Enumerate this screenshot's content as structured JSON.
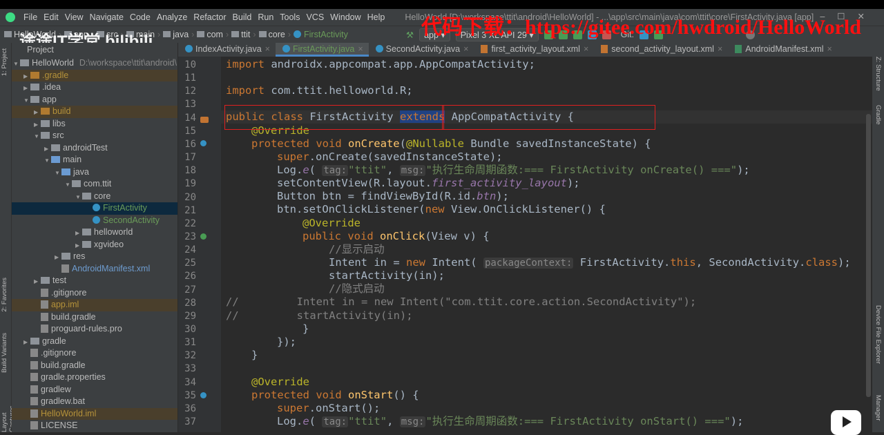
{
  "menu": [
    "File",
    "Edit",
    "View",
    "Navigate",
    "Code",
    "Analyze",
    "Refactor",
    "Build",
    "Run",
    "Tools",
    "VCS",
    "Window",
    "Help"
  ],
  "window_title": "HelloWorld [D:\\workspace\\ttit\\android\\HelloWorld] - ...\\app\\src\\main\\java\\com\\ttit\\core\\FirstActivity.java [app]",
  "watermark": "代码下载：https://gitee.com/hwdroid/HelloWorld",
  "overlay_logo": "途途IT学堂 bilibili",
  "breadcrumb": [
    "HelloWorld",
    "app",
    "src",
    "main",
    "java",
    "com",
    "ttit",
    "core",
    "FirstActivity"
  ],
  "toolbar": {
    "run_config": "app",
    "device": "Pixel 3 XL API 29",
    "git_label": "Git:"
  },
  "panel": {
    "title": "Project"
  },
  "left_stripe": [
    "1: Project",
    "2: Favorites",
    "Build Variants",
    "Layout Captures"
  ],
  "right_stripe": [
    "Z: Structure",
    "Gradle",
    "Device File Explorer",
    "Resource Manager"
  ],
  "tree": [
    {
      "label": "HelloWorld",
      "path": "D:\\workspace\\ttit\\android\\HelloWo"
    },
    {
      "label": ".gradle"
    },
    {
      "label": ".idea"
    },
    {
      "label": "app"
    },
    {
      "label": "build"
    },
    {
      "label": "libs"
    },
    {
      "label": "src"
    },
    {
      "label": "androidTest"
    },
    {
      "label": "main"
    },
    {
      "label": "java"
    },
    {
      "label": "com.ttit"
    },
    {
      "label": "core"
    },
    {
      "label": "FirstActivity"
    },
    {
      "label": "SecondActivity"
    },
    {
      "label": "helloworld"
    },
    {
      "label": "xgvideo"
    },
    {
      "label": "res"
    },
    {
      "label": "AndroidManifest.xml"
    },
    {
      "label": "test"
    },
    {
      "label": ".gitignore"
    },
    {
      "label": "app.iml"
    },
    {
      "label": "build.gradle"
    },
    {
      "label": "proguard-rules.pro"
    },
    {
      "label": "gradle"
    },
    {
      "label": ".gitignore"
    },
    {
      "label": "build.gradle"
    },
    {
      "label": "gradle.properties"
    },
    {
      "label": "gradlew"
    },
    {
      "label": "gradlew.bat"
    },
    {
      "label": "HelloWorld.iml"
    },
    {
      "label": "LICENSE"
    }
  ],
  "tabs": [
    "IndexActivity.java",
    "FirstActivity.java",
    "SecondActivity.java",
    "first_activity_layout.xml",
    "second_activity_layout.xml",
    "AndroidManifest.xml"
  ],
  "line_numbers": [
    "10",
    "11",
    "12",
    "13",
    "14",
    "15",
    "16",
    "17",
    "18",
    "19",
    "20",
    "21",
    "22",
    "23",
    "24",
    "25",
    "26",
    "27",
    "28",
    "29",
    "30",
    "31",
    "32",
    "33",
    "34",
    "35",
    "36",
    "37"
  ],
  "code": {
    "l10a": "import ",
    "l10b": "androidx.appcompat.app.AppCompatActivity;",
    "l12a": "import ",
    "l12b": "com.ttit.helloworld.R;",
    "l14a": "public class ",
    "l14b": "FirstActivity ",
    "l14c": "extends",
    "l14d": " AppCompatActivity {",
    "ov": "@Override",
    "l16a": "protected void ",
    "l16b": "onCreate",
    "l16c": "(",
    "l16d": "@Nullable",
    "l16e": " Bundle savedInstanceState) {",
    "l17a": "super",
    "l17b": ".onCreate(savedInstanceState);",
    "l18a": "Log.",
    "l18b": "e",
    "l18c": "( ",
    "tag": "tag:",
    "l18d": "\"ttit\"",
    ", ": ", ",
    "msg": "msg:",
    "l18e": "\"执行生命周期函数:=== FirstActivity onCreate() ===\"",
    "l18f": ");",
    "l19a": "setContentView(R.layout.",
    "l19b": "first_activity_layout",
    "l19c": ");",
    "l20a": "Button btn = findViewById(R.id.",
    "l20b": "btn",
    "l20c": ");",
    "l21a": "btn.setOnClickListener(",
    "l21b": "new ",
    "l21c": "View.OnClickListener() {",
    "l23a": "public void ",
    "l23b": "onClick",
    "l23c": "(View v) {",
    "l24": "//显示启动",
    "l25a": "Intent in = ",
    "l25b": "new ",
    "l25c": "Intent( ",
    "pc": "packageContext:",
    "l25d": " FirstActivity.",
    "this": "this",
    ", s": ", SecondActivity.",
    "class": "class",
    "l25e": ");",
    "l26": "startActivity(in);",
    "l27": "//隐式启动",
    "l28": "//         Intent in = new Intent(\"com.ttit.core.action.SecondActivity\");",
    "l29": "//         startActivity(in);",
    "l30": "}",
    "l31": "});",
    "l32": "}",
    "l35b": "onStart",
    "l35c": "() {",
    "l36b": ".onStart();",
    "l37e": "\"执行生命周期函数:=== FirstActivity onStart() ===\""
  }
}
